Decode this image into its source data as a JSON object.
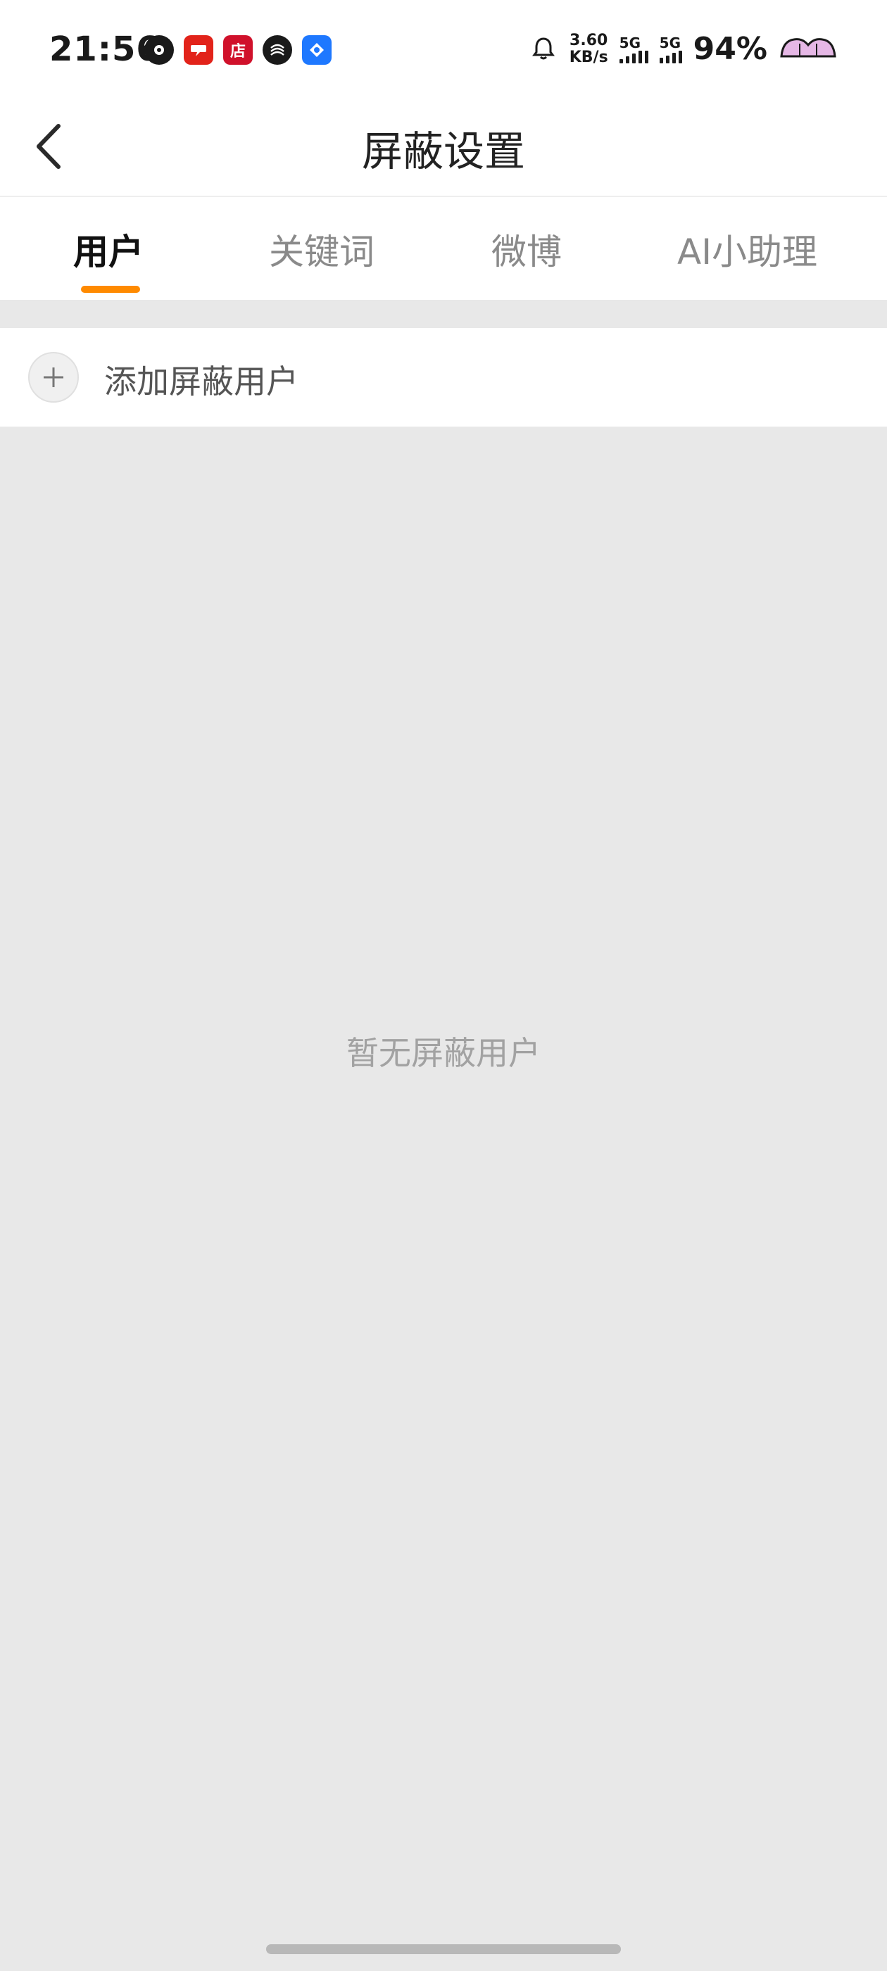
{
  "status_bar": {
    "time": "21:56",
    "net_speed_value": "3.60",
    "net_speed_unit": "KB/s",
    "sim1_label": "5G",
    "sim2_label": "5G",
    "battery_percent": "94%",
    "app_icons": [
      "app-icon-1",
      "news-app-icon",
      "store-app-icon",
      "mobile-app-icon",
      "blue-app-icon"
    ],
    "app_icon_store_label": "店"
  },
  "nav": {
    "title": "屏蔽设置"
  },
  "tabs": [
    {
      "label": "用户",
      "active": true
    },
    {
      "label": "关键词",
      "active": false
    },
    {
      "label": "微博",
      "active": false
    },
    {
      "label": "AI小助理",
      "active": false
    }
  ],
  "add_row": {
    "label": "添加屏蔽用户"
  },
  "empty_state": {
    "text": "暂无屏蔽用户"
  },
  "colors": {
    "accent": "#ff8a00",
    "background": "#e8e8e8",
    "surface": "#ffffff"
  }
}
